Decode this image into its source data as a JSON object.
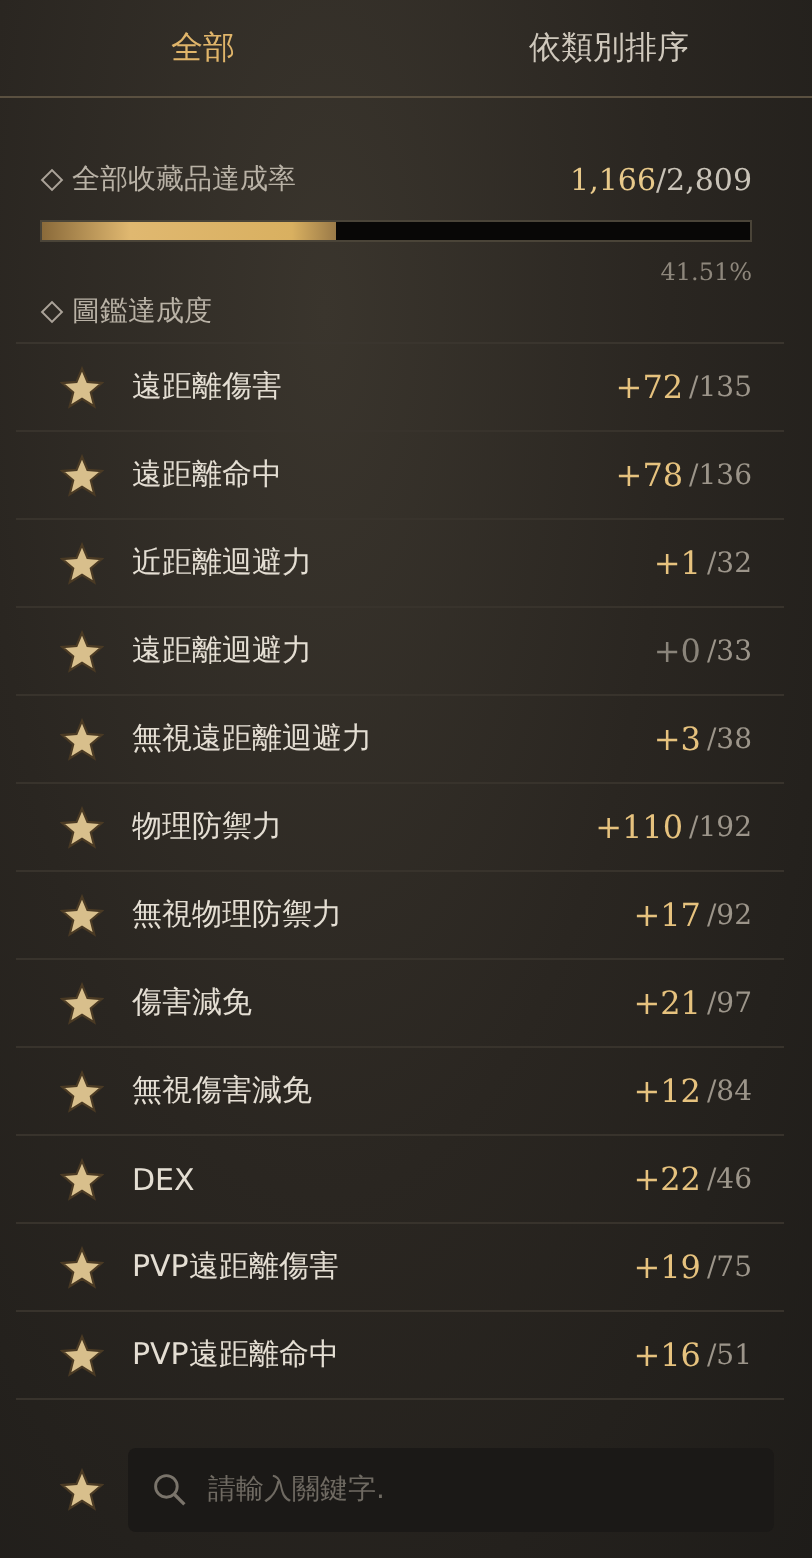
{
  "tabs": [
    {
      "label": "全部",
      "selected": true
    },
    {
      "label": "依類別排序",
      "selected": false
    }
  ],
  "total": {
    "label": "全部收藏品達成率",
    "current": "1,166",
    "max": "/2,809",
    "level": 0.4151,
    "percent": "41.51%"
  },
  "section": {
    "label": "圖鑑達成度"
  },
  "rows": [
    {
      "name": "遠距離傷害",
      "bonus": "+72",
      "max": "/135",
      "active": true
    },
    {
      "name": "遠距離命中",
      "bonus": "+78",
      "max": "/136",
      "active": true
    },
    {
      "name": "近距離迴避力",
      "bonus": "+1",
      "max": "/32",
      "active": true
    },
    {
      "name": "遠距離迴避力",
      "bonus": "+0",
      "max": "/33",
      "active": false
    },
    {
      "name": "無視遠距離迴避力",
      "bonus": "+3",
      "max": "/38",
      "active": true
    },
    {
      "name": "物理防禦力",
      "bonus": "+110",
      "max": "/192",
      "active": true
    },
    {
      "name": "無視物理防禦力",
      "bonus": "+17",
      "max": "/92",
      "active": true
    },
    {
      "name": "傷害減免",
      "bonus": "+21",
      "max": "/97",
      "active": true
    },
    {
      "name": "無視傷害減免",
      "bonus": "+12",
      "max": "/84",
      "active": true
    },
    {
      "name": "DEX",
      "bonus": "+22",
      "max": "/46",
      "active": true
    },
    {
      "name": "PVP遠距離傷害",
      "bonus": "+19",
      "max": "/75",
      "active": true
    },
    {
      "name": "PVP遠距離命中",
      "bonus": "+16",
      "max": "/51",
      "active": true
    }
  ],
  "search": {
    "placeholder": "請輸入關鍵字."
  }
}
